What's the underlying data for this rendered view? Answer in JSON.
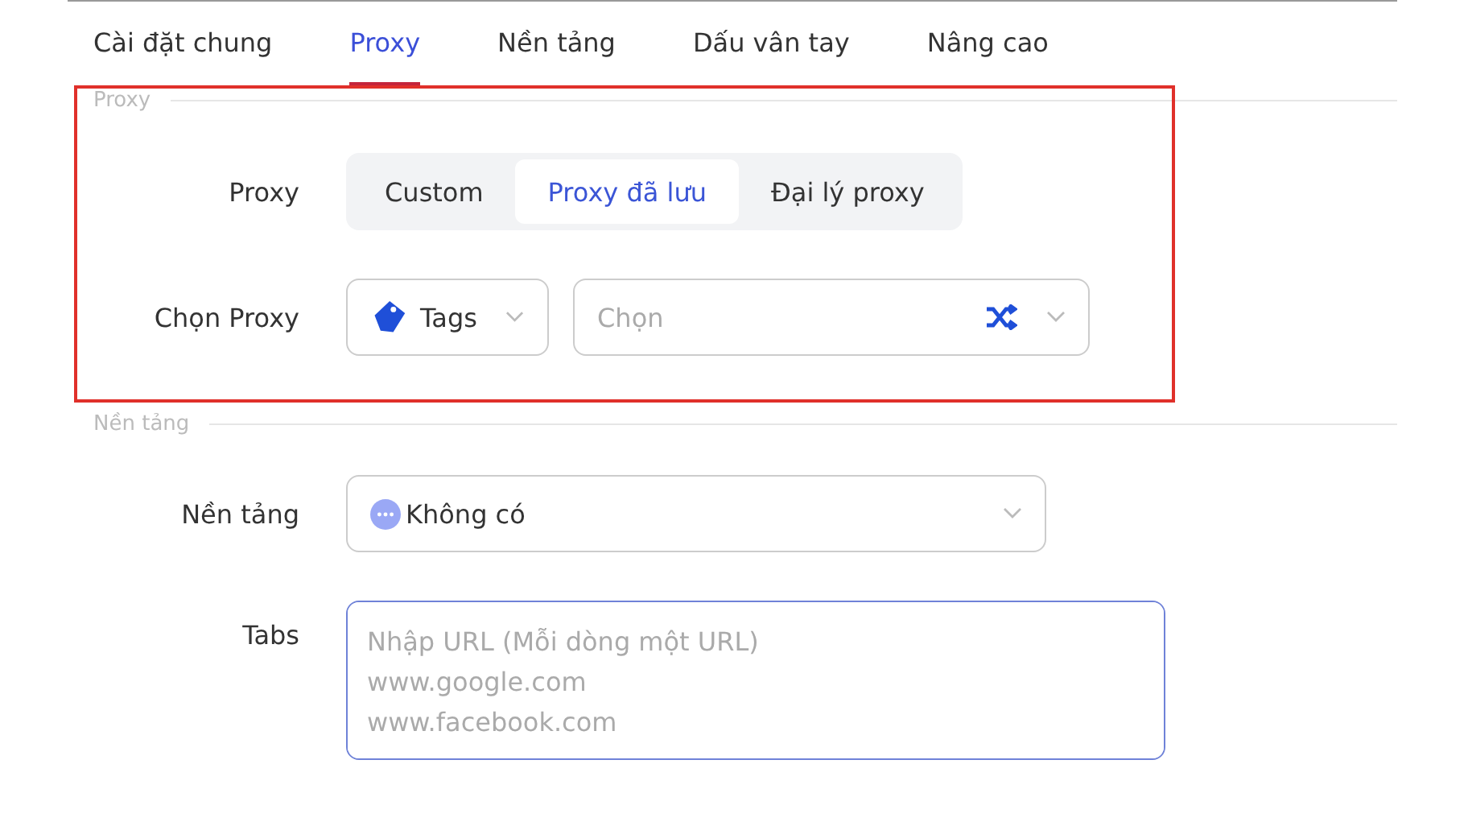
{
  "tabs": [
    {
      "label": "Cài đặt chung",
      "selected": false
    },
    {
      "label": "Proxy",
      "selected": true
    },
    {
      "label": "Nền tảng",
      "selected": false
    },
    {
      "label": "Dấu vân tay",
      "selected": false
    },
    {
      "label": "Nâng cao",
      "selected": false
    }
  ],
  "proxy_section": {
    "legend": "Proxy",
    "highlighted": true,
    "proxy_label": "Proxy",
    "modes": [
      {
        "label": "Custom",
        "selected": false
      },
      {
        "label": "Proxy đã lưu",
        "selected": true
      },
      {
        "label": "Đại lý proxy",
        "selected": false
      }
    ],
    "choose_label": "Chọn Proxy",
    "tag_select": {
      "value": "Tags"
    },
    "proxy_select": {
      "placeholder": "Chọn"
    }
  },
  "platform_section": {
    "legend": "Nền tảng",
    "platform_label": "Nền tảng",
    "platform_select": {
      "value": "Không có"
    },
    "tabs_label": "Tabs",
    "tabs_field": {
      "placeholder": "Nhập URL (Mỗi dòng một URL)\nwww.google.com\nwww.facebook.com"
    }
  }
}
